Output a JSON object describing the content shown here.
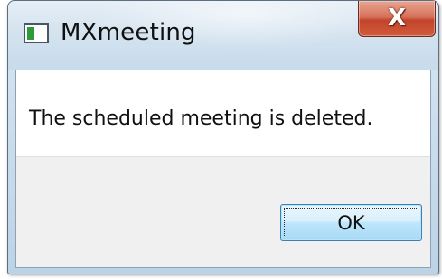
{
  "window": {
    "title": "MXmeeting",
    "close_glyph": "X",
    "icon": "app-window-icon"
  },
  "dialog": {
    "message": "The scheduled meeting is deleted.",
    "ok_label": "OK"
  },
  "colors": {
    "close_button": "#c0442a",
    "ok_button_border": "#3c7fb1",
    "footer_background": "#f0f0f0"
  }
}
